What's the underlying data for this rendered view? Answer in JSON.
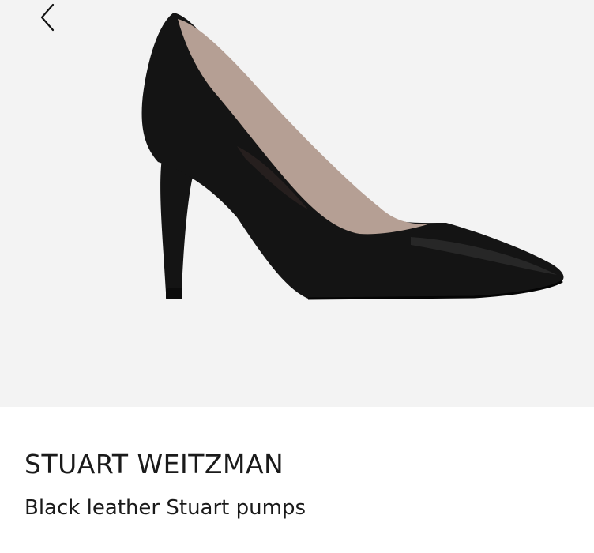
{
  "product": {
    "brand": "STUART WEITZMAN",
    "name": "Black leather Stuart pumps"
  },
  "nav": {
    "back_icon": "chevron-left-icon"
  },
  "colors": {
    "image_background": "#f3f3f3",
    "text": "#1a1a1a",
    "shoe_leather": "#141414",
    "shoe_lining": "#b59f94"
  }
}
